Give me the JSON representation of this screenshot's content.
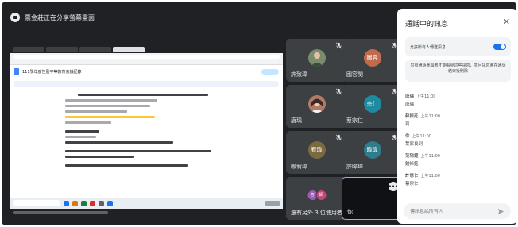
{
  "meeting": {
    "presenting_label": "票金莊正在分享螢幕畫面"
  },
  "shared_screen": {
    "doc_title": "111學年度性別平等教育會議紀錄"
  },
  "tiles": [
    {
      "name": "許致瑋",
      "muted": true,
      "avatar_type": "photo",
      "avatar_color": "#7a8c6b"
    },
    {
      "name": "國容閔",
      "muted": true,
      "avatar_type": "initials",
      "initials": "圖容",
      "avatar_color": "#c26b4c"
    },
    {
      "name": "唐瑀",
      "muted": true,
      "avatar_type": "photo",
      "avatar_color": "#b07a68"
    },
    {
      "name": "蔡宗仁",
      "muted": true,
      "avatar_type": "initials",
      "initials": "宗仁",
      "avatar_color": "#1e8aa0"
    },
    {
      "name": "賴宥瑋",
      "muted": true,
      "avatar_type": "initials",
      "initials": "宥瑋",
      "avatar_color": "#7c6a3f"
    },
    {
      "name": "許暐瑋",
      "muted": true,
      "avatar_type": "initials",
      "initials": "暐瑋",
      "avatar_color": "#2e7d8a"
    },
    {
      "name": "還有另外 3 位使用者",
      "muted": false,
      "avatar_type": "group",
      "group": [
        {
          "initials": "容",
          "color": "#9c5bb5"
        },
        {
          "initials": "師",
          "color": "#c2457a"
        }
      ]
    },
    {
      "name": "你",
      "muted": false,
      "avatar_type": "self"
    }
  ],
  "chat": {
    "title": "通話中的訊息",
    "toggle_label": "允許所有人傳送訊息",
    "toggle_on": true,
    "notice": "只有通話參與者才能看見這些訊息，並且訊息會在通話結束後刪除",
    "messages": [
      {
        "sender": "唐瑀",
        "time": "上午11:00",
        "text": "唐瑀"
      },
      {
        "sender": "蘇振延",
        "time": "上午11:00",
        "text": "到"
      },
      {
        "sender": "你",
        "time": "上午11:00",
        "text": "葉家良到"
      },
      {
        "sender": "范陽鐘",
        "time": "上午11:00",
        "text": "鍾修銘"
      },
      {
        "sender": "許惠仁",
        "time": "上午11:00",
        "text": "蔡宗仁"
      }
    ],
    "input_placeholder": "傳訊息給所有人"
  },
  "colors": {
    "background": "#202124",
    "tile": "#3c4043",
    "accent": "#1a73e8",
    "self_border": "#8ab4f8"
  }
}
